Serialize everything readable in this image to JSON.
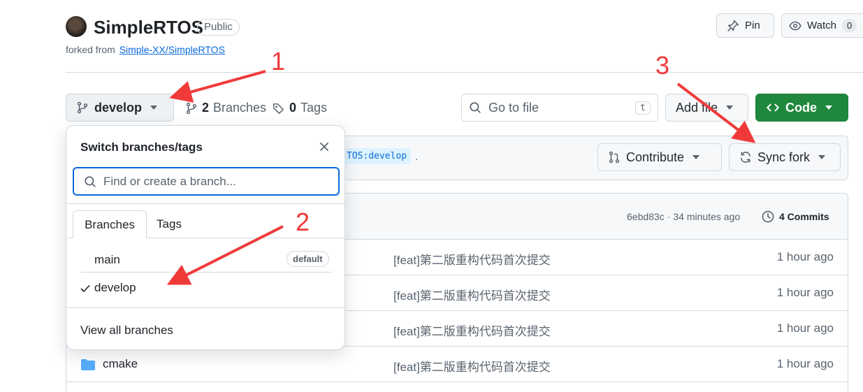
{
  "repo": {
    "name": "SimpleRTOS",
    "visibility": "Public",
    "forked_prefix": "forked from",
    "forked_link": "Simple-XX/SimpleRTOS"
  },
  "header_actions": {
    "pin": "Pin",
    "watch": "Watch",
    "watch_count": "0"
  },
  "toolbar": {
    "branch": "develop",
    "branches_count": "2",
    "branches_label": "Branches",
    "tags_count": "0",
    "tags_label": "Tags",
    "go_to_file_placeholder": "Go to file",
    "go_to_file_key": "t",
    "add_file": "Add file",
    "code": "Code"
  },
  "fork_bar": {
    "ref_fragment": "TOS:develop",
    "trailing": ".",
    "contribute": "Contribute",
    "sync_fork": "Sync fork"
  },
  "commit_bar": {
    "sha": "6ebd83c",
    "separator": "·",
    "time": "34 minutes ago",
    "commits": "4 Commits"
  },
  "file_rows": [
    {
      "name": "",
      "message": "[feat]第二版重构代码首次提交",
      "age": "1 hour ago"
    },
    {
      "name": "",
      "message": "[feat]第二版重构代码首次提交",
      "age": "1 hour ago"
    },
    {
      "name": "",
      "message": "[feat]第二版重构代码首次提交",
      "age": "1 hour ago"
    },
    {
      "name": "cmake",
      "message": "[feat]第二版重构代码首次提交",
      "age": "1 hour ago"
    }
  ],
  "dropdown": {
    "title": "Switch branches/tags",
    "search_placeholder": "Find or create a branch...",
    "tabs": [
      "Branches",
      "Tags"
    ],
    "branches": [
      {
        "name": "main",
        "badge": "default",
        "checked": false
      },
      {
        "name": "develop",
        "badge": "",
        "checked": true
      }
    ],
    "view_all": "View all branches"
  },
  "annotations": {
    "arrow1_label": "1",
    "arrow2_label": "2",
    "arrow3_label": "3",
    "arrow_color": "#f03a3a"
  },
  "colors": {
    "code_button": "#1f883d",
    "link": "#0969da",
    "folder": "#54aeff",
    "focus": "#0969da"
  }
}
